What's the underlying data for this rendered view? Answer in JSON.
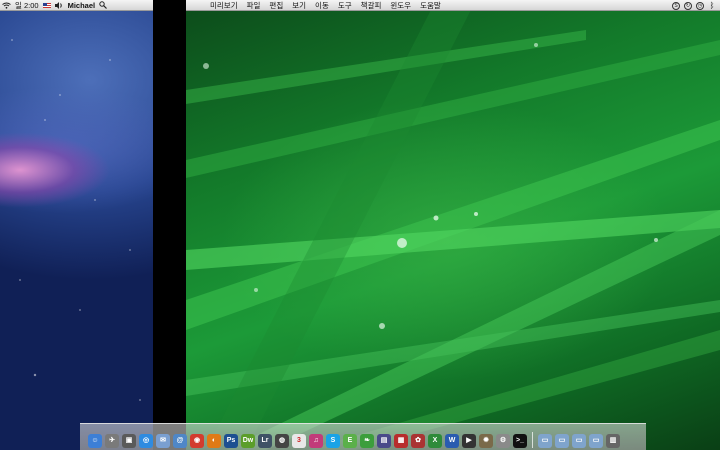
{
  "left_menubar": {
    "time": "일 2:00",
    "user": "Michael",
    "icons": [
      "wifi-icon",
      "flag-us-icon",
      "volume-icon",
      "search-icon"
    ]
  },
  "right_menubar": {
    "apple": "",
    "menus": [
      "미리보기",
      "파일",
      "편집",
      "보기",
      "이동",
      "도구",
      "책갈피",
      "윈도우",
      "도움말"
    ],
    "status_icons": [
      "skype-icon",
      "sync-icon",
      "time-machine-icon",
      "bluetooth-icon"
    ]
  },
  "dock": {
    "icons": [
      {
        "name": "finder-icon",
        "glyph": "☺",
        "color": "#3d7fd6"
      },
      {
        "name": "rocket-icon",
        "glyph": "✈",
        "color": "#7a7a7a"
      },
      {
        "name": "photo-icon",
        "glyph": "▣",
        "color": "#5a5a5a"
      },
      {
        "name": "safari-icon",
        "glyph": "◎",
        "color": "#2f8be0"
      },
      {
        "name": "mail-icon",
        "glyph": "✉",
        "color": "#7a9fd0"
      },
      {
        "name": "contacts-icon",
        "glyph": "@",
        "color": "#4f87c7"
      },
      {
        "name": "chrome-icon",
        "glyph": "◉",
        "color": "#d33c2e"
      },
      {
        "name": "firefox-icon",
        "glyph": "◐",
        "color": "#e07a16"
      },
      {
        "name": "photoshop-icon",
        "glyph": "Ps",
        "color": "#1d4f91"
      },
      {
        "name": "dreamweaver-icon",
        "glyph": "Dw",
        "color": "#5b9e2a"
      },
      {
        "name": "lightroom-icon",
        "glyph": "Lr",
        "color": "#3f5266"
      },
      {
        "name": "camera-icon",
        "glyph": "◍",
        "color": "#444"
      },
      {
        "name": "calendar-icon",
        "glyph": "3",
        "color": "#e8e8e8"
      },
      {
        "name": "itunes-icon",
        "glyph": "♫",
        "color": "#c23b7a"
      },
      {
        "name": "skype-icon",
        "glyph": "S",
        "color": "#19a3e6"
      },
      {
        "name": "evernote-icon",
        "glyph": "E",
        "color": "#5bb04a"
      },
      {
        "name": "leaf-icon",
        "glyph": "❧",
        "color": "#3c9e3c"
      },
      {
        "name": "app-store-icon",
        "glyph": "▤",
        "color": "#4a4a8a"
      },
      {
        "name": "parallels-icon",
        "glyph": "▦",
        "color": "#b82d2d"
      },
      {
        "name": "photo-booth-icon",
        "glyph": "✿",
        "color": "#a33"
      },
      {
        "name": "excel-icon",
        "glyph": "X",
        "color": "#2e8b3a"
      },
      {
        "name": "word-icon",
        "glyph": "W",
        "color": "#2a5cb0"
      },
      {
        "name": "dvd-icon",
        "glyph": "▶",
        "color": "#333"
      },
      {
        "name": "maps-icon",
        "glyph": "✹",
        "color": "#7a6a4a"
      },
      {
        "name": "system-prefs-icon",
        "glyph": "⚙",
        "color": "#8a8a8a"
      },
      {
        "name": "terminal-icon",
        "glyph": ">_",
        "color": "#111"
      },
      {
        "name": "folder-applications-icon",
        "glyph": "▭",
        "color": "#7fa4cc"
      },
      {
        "name": "folder-documents-icon",
        "glyph": "▭",
        "color": "#7fa4cc"
      },
      {
        "name": "folder-downloads-icon",
        "glyph": "▭",
        "color": "#7fa4cc"
      },
      {
        "name": "folder-stack-icon",
        "glyph": "▭",
        "color": "#7fa4cc"
      },
      {
        "name": "trash-icon",
        "glyph": "▥",
        "color": "#666"
      }
    ]
  }
}
